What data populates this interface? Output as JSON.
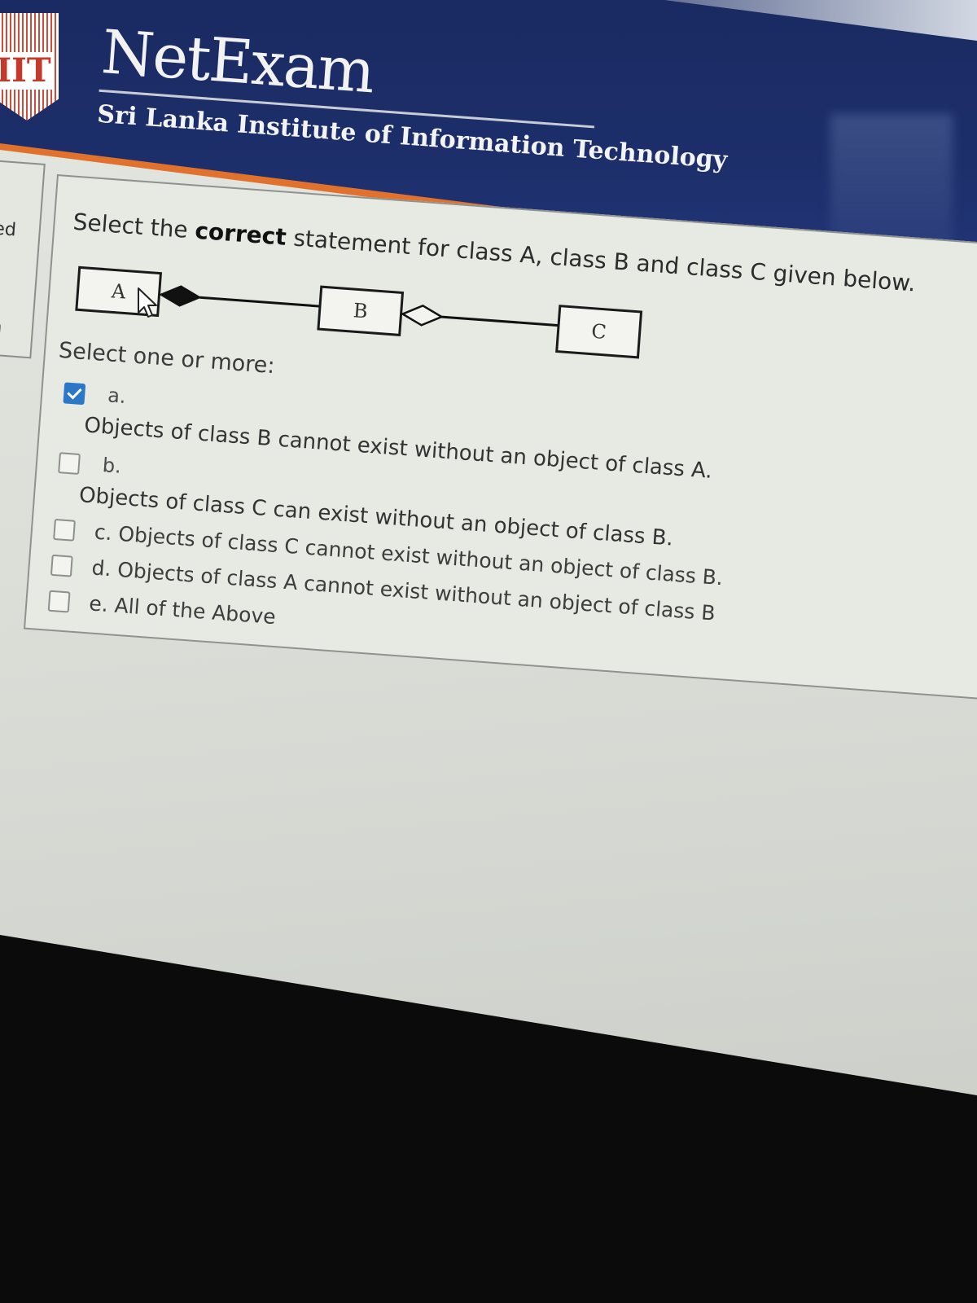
{
  "header": {
    "logo_text": "IIT",
    "brand": "NetExam",
    "institution": "Sri Lanka Institute of Information Technology"
  },
  "sidebar": {
    "items": [
      {
        "label": "red"
      },
      {
        "label": "on"
      }
    ]
  },
  "question": {
    "text_before": "Select the ",
    "text_bold": "correct",
    "text_after": " statement for class A, class B and class C given below.",
    "diagram": {
      "class_a": "A",
      "class_b": "B",
      "class_c": "C"
    },
    "prompt": "Select one or more:",
    "options": [
      {
        "letter": "a.",
        "text": "Objects of class B cannot exist without an object of class A.",
        "checked": true
      },
      {
        "letter": "b.",
        "text": "Objects of class C can exist without an object of class B.",
        "checked": false
      },
      {
        "letter": "",
        "text": "c. Objects of class C cannot exist without an object of class B.",
        "checked": false
      },
      {
        "letter": "",
        "text": "d. Objects of class A cannot exist without an object of class B",
        "checked": false
      },
      {
        "letter": "",
        "text": "e. All of the Above",
        "checked": false
      }
    ]
  },
  "colors": {
    "header_blue": "#1d2f6b",
    "accent_orange": "#e0722d",
    "checkbox_blue": "#2a78c6"
  }
}
